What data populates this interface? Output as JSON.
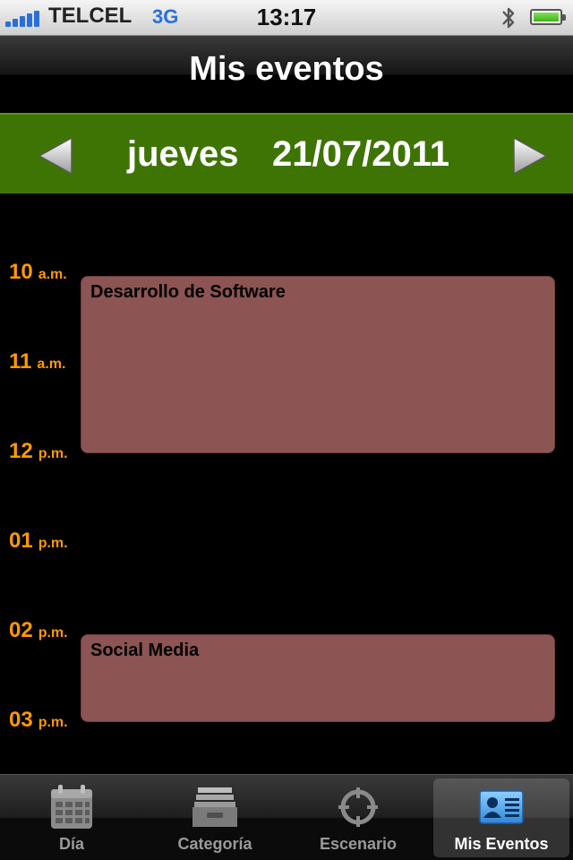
{
  "status_bar": {
    "carrier": "TELCEL",
    "network": "3G",
    "time": "13:17",
    "icons": [
      "signal-icon",
      "bluetooth-icon",
      "battery-icon"
    ]
  },
  "nav": {
    "title": "Mis eventos"
  },
  "date_bar": {
    "weekday": "jueves",
    "date": "21/07/2011",
    "prev_icon": "arrow-left-icon",
    "next_icon": "arrow-right-icon",
    "color": "#3e7404"
  },
  "hours": [
    {
      "h": "10",
      "ap": "a.m."
    },
    {
      "h": "11",
      "ap": "a.m."
    },
    {
      "h": "12",
      "ap": "p.m."
    },
    {
      "h": "01",
      "ap": "p.m."
    },
    {
      "h": "02",
      "ap": "p.m."
    },
    {
      "h": "03",
      "ap": "p.m."
    }
  ],
  "events": [
    {
      "title": "Desarrollo de Software",
      "start": "10",
      "end": "12"
    },
    {
      "title": "Social Media",
      "start": "02",
      "end": "03"
    }
  ],
  "colors": {
    "hour_label": "#ff9900",
    "event": "#8c5452"
  },
  "tabs": [
    {
      "label": "Día",
      "icon": "calendar-icon",
      "active": false
    },
    {
      "label": "Categoría",
      "icon": "inbox-tray-icon",
      "active": false
    },
    {
      "label": "Escenario",
      "icon": "target-icon",
      "active": false
    },
    {
      "label": "Mis Eventos",
      "icon": "contact-card-icon",
      "active": true
    }
  ]
}
